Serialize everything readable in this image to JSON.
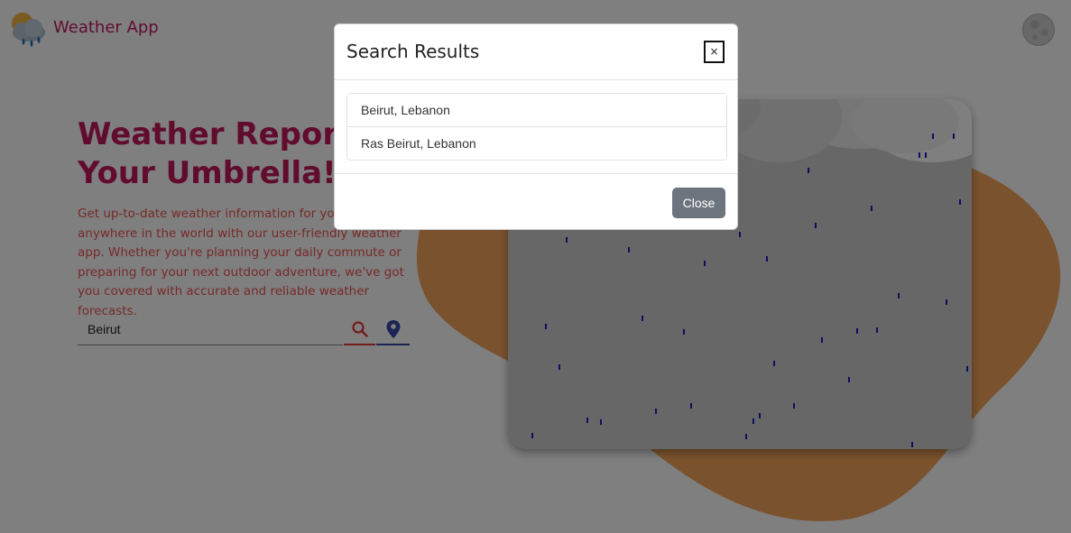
{
  "header": {
    "brand_title": "Weather App",
    "logo_icon": "cloud-sun-rain-icon",
    "theme_toggle_icon": "moon-icon"
  },
  "hero": {
    "title": "Weather Report: Don't Forget Your Umbrella!",
    "title_visible_line1": "Weather Report: D",
    "title_visible_line2": "Your Umbrella!",
    "description": "Get up-to-date weather information for your location, anywhere in the world with our user-friendly weather app. Whether you're planning your daily commute or preparing for your next outdoor adventure, we've got you covered with accurate and reliable weather forecasts."
  },
  "search": {
    "value": "Beirut",
    "search_icon": "search-icon",
    "location_icon": "map-pin-icon"
  },
  "illustration": {
    "icon": "rain-cloud-illustration"
  },
  "modal": {
    "title": "Search Results",
    "close_x_label": "×",
    "results": [
      {
        "label": "Beirut, Lebanon"
      },
      {
        "label": "Ras Beirut, Lebanon"
      }
    ],
    "close_button_label": "Close"
  },
  "colors": {
    "brand": "#c2185b",
    "description_text": "#ef5350",
    "search_underline": "#e53935",
    "locate_underline": "#3949ab",
    "blob": "#f5a55a",
    "raindrop": "#1a1acc",
    "close_button": "#6c757d"
  }
}
